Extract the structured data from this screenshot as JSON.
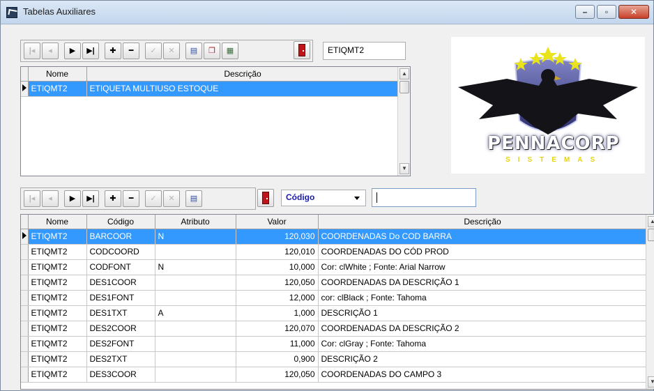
{
  "window": {
    "title": "Tabelas Auxiliares"
  },
  "top_panel": {
    "search_value": "ETIQMT2",
    "grid": {
      "columns": [
        "Nome",
        "Descrição"
      ],
      "rows": [
        {
          "nome": "ETIQMT2",
          "descricao": "ETIQUETA MULTIUSO ESTOQUE",
          "selected": true
        }
      ]
    }
  },
  "logo": {
    "brand": "PENNACORP",
    "sub": "SISTEMAS"
  },
  "bottom_panel": {
    "filter_field": "Código",
    "filter_value": "",
    "grid": {
      "columns": [
        "Nome",
        "Código",
        "Atributo",
        "Valor",
        "Descrição"
      ],
      "rows": [
        {
          "nome": "ETIQMT2",
          "codigo": "BARCOOR",
          "atributo": "N",
          "valor": "120,030",
          "descricao": "COORDENADAS Do COD BARRA",
          "selected": true
        },
        {
          "nome": "ETIQMT2",
          "codigo": "CODCOORD",
          "atributo": "",
          "valor": "120,010",
          "descricao": "COORDENADAS DO CÓD PROD"
        },
        {
          "nome": "ETIQMT2",
          "codigo": "CODFONT",
          "atributo": "N",
          "valor": "10,000",
          "descricao": "Cor: clWhite   ; Fonte: Arial Narrow"
        },
        {
          "nome": "ETIQMT2",
          "codigo": "DES1COOR",
          "atributo": "",
          "valor": "120,050",
          "descricao": "COORDENADAS DA DESCRIÇÃO 1"
        },
        {
          "nome": "ETIQMT2",
          "codigo": "DES1FONT",
          "atributo": "",
          "valor": "12,000",
          "descricao": "cor: clBlack ; Fonte: Tahoma"
        },
        {
          "nome": "ETIQMT2",
          "codigo": "DES1TXT",
          "atributo": "A",
          "valor": "1,000",
          "descricao": "DESCRIÇÃO 1"
        },
        {
          "nome": "ETIQMT2",
          "codigo": "DES2COOR",
          "atributo": "",
          "valor": "120,070",
          "descricao": "COORDENADAS DA DESCRIÇÃO 2"
        },
        {
          "nome": "ETIQMT2",
          "codigo": "DES2FONT",
          "atributo": "",
          "valor": "11,000",
          "descricao": "Cor: clGray   ; Fonte: Tahoma"
        },
        {
          "nome": "ETIQMT2",
          "codigo": "DES2TXT",
          "atributo": "",
          "valor": "0,900",
          "descricao": "DESCRIÇÃO 2"
        },
        {
          "nome": "ETIQMT2",
          "codigo": "DES3COOR",
          "atributo": "",
          "valor": "120,050",
          "descricao": "COORDENADAS DO CAMPO 3"
        }
      ]
    }
  },
  "colors": {
    "selection": "#3399ff",
    "filter_text": "#1a1ab3",
    "exit_door": "#c0141b"
  }
}
